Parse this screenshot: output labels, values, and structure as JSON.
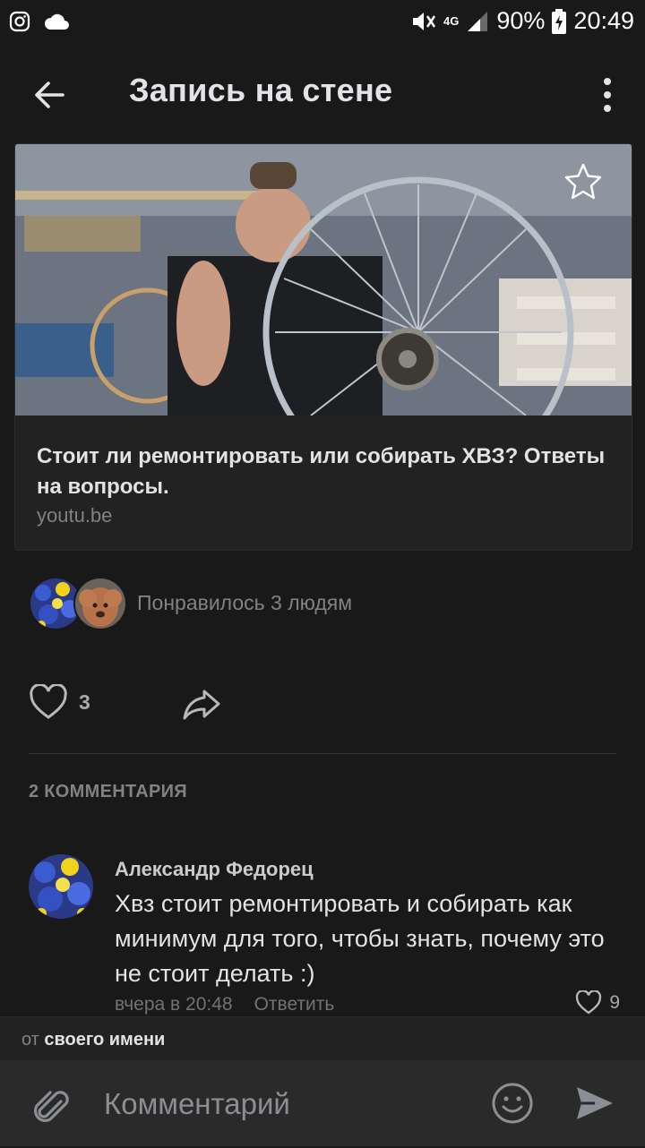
{
  "status_bar": {
    "network": "4G",
    "battery": "90%",
    "time": "20:49"
  },
  "header": {
    "title": "Запись на стене"
  },
  "link_card": {
    "title": "Стоит ли ремонтировать или собирать ХВЗ? Ответы на вопросы.",
    "domain": "youtu.be"
  },
  "likes": {
    "text": "Понравилось 3 людям",
    "count": "3"
  },
  "comments": {
    "header": "2 КОММЕНТАРИЯ",
    "items": [
      {
        "author": "Александр Федорец",
        "text": "Хвз стоит ремонтировать и собирать как минимум для того, чтобы знать, почему это не стоит делать :)",
        "time": "вчера в 20:48",
        "reply_label": "Ответить",
        "likes": "9"
      }
    ]
  },
  "composer": {
    "from_prefix": "от",
    "from_name": "своего имени",
    "placeholder": "Комментарий"
  },
  "colors": {
    "background": "#191919",
    "card": "#222222",
    "text_primary": "#e1e3e6",
    "text_secondary": "#828282"
  }
}
